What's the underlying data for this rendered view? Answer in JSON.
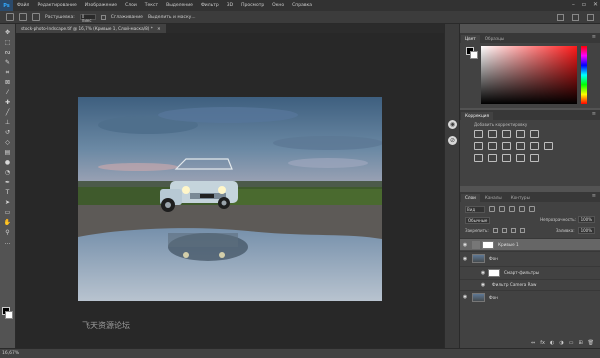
{
  "menubar": {
    "logo": "Ps",
    "items": [
      "Файл",
      "Редактирование",
      "Изображение",
      "Слои",
      "Текст",
      "Выделение",
      "Фильтр",
      "3D",
      "Просмотр",
      "Окно",
      "Справка"
    ],
    "controls": [
      "–",
      "▫",
      "✕"
    ]
  },
  "options": {
    "feather_label": "Растушевка:",
    "feather_value": "0 пикс",
    "antialias_label": "Сглаживание",
    "refine_label": "Выделить и маску..."
  },
  "document": {
    "tab_title": "stock-photo-lndscape.tif @ 16,7% (Кривые 1, Слой-маска/8) *",
    "close": "✕"
  },
  "status": {
    "zoom": "16,67%"
  },
  "watermark": "飞天资源论坛",
  "color_panel": {
    "tabs": [
      "Цвет",
      "Образцы"
    ],
    "menu": "≡"
  },
  "adjust_panel": {
    "tabs": [
      "Коррекция"
    ],
    "hint": "Добавить корректировку",
    "menu": "≡"
  },
  "layers_panel": {
    "tabs": [
      "Слои",
      "Каналы",
      "Контуры"
    ],
    "menu": "≡",
    "kind": "Вид",
    "blend_mode": "Обычные",
    "opacity_label": "Непрозрачность:",
    "opacity_value": "100%",
    "lock_label": "Закрепить:",
    "fill_label": "Заливка:",
    "fill_value": "100%",
    "layers": [
      {
        "name": "Кривые 1",
        "selected": true
      },
      {
        "name": "Фон"
      },
      {
        "name": "Смарт-фильтры"
      },
      {
        "name": "Фильтр Camera Raw"
      },
      {
        "name": "Фон"
      }
    ],
    "footer": [
      "⇔",
      "fx",
      "◐",
      "◑",
      "▭",
      "⊞",
      "🗑"
    ]
  },
  "colors": {
    "bg": "#535353",
    "panel": "#424242",
    "canvas": "#282828"
  }
}
